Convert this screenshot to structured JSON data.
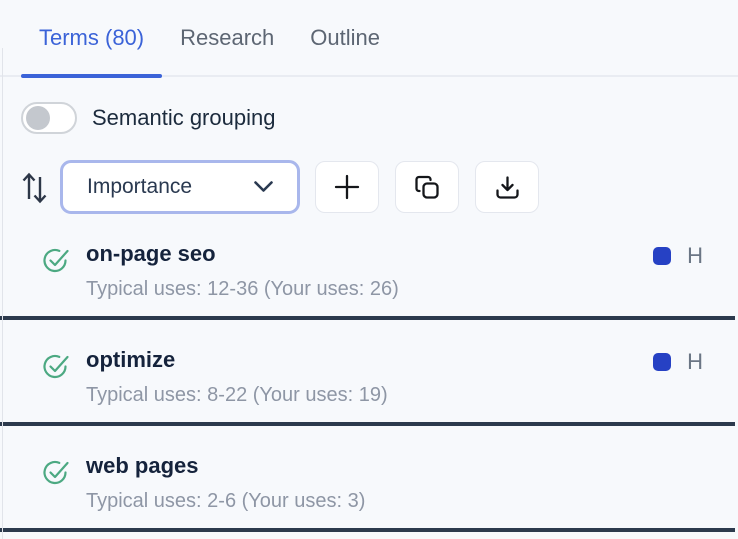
{
  "tabs": [
    {
      "label": "Terms (80)",
      "active": true
    },
    {
      "label": "Research",
      "active": false
    },
    {
      "label": "Outline",
      "active": false
    }
  ],
  "toggle": {
    "label": "Semantic grouping",
    "state": "off"
  },
  "sort": {
    "dropdown_value": "Importance"
  },
  "toolbar_icons": [
    "sort-direction-icon",
    "add-term-icon",
    "copy-icon",
    "download-icon"
  ],
  "terms": [
    {
      "term": "on-page seo",
      "usage": "Typical uses: 12-36 (Your uses: 26)",
      "typical_uses": "12-36",
      "your_uses": 26,
      "importance": "H",
      "has_badge": true,
      "status": "complete"
    },
    {
      "term": "optimize",
      "usage": "Typical uses: 8-22 (Your uses: 19)",
      "typical_uses": "8-22",
      "your_uses": 19,
      "importance": "H",
      "has_badge": true,
      "status": "complete"
    },
    {
      "term": "web pages",
      "usage": "Typical uses: 2-6 (Your uses: 3)",
      "typical_uses": "2-6",
      "your_uses": 3,
      "importance": "",
      "has_badge": false,
      "status": "complete"
    }
  ],
  "colors": {
    "accent_blue": "#3b63d8",
    "badge_blue": "#2641c4",
    "check_green": "#4ca982",
    "separator_dark": "#2c3a4d",
    "dropdown_border": "#a9b7ec",
    "background": "#f7f9fc"
  }
}
